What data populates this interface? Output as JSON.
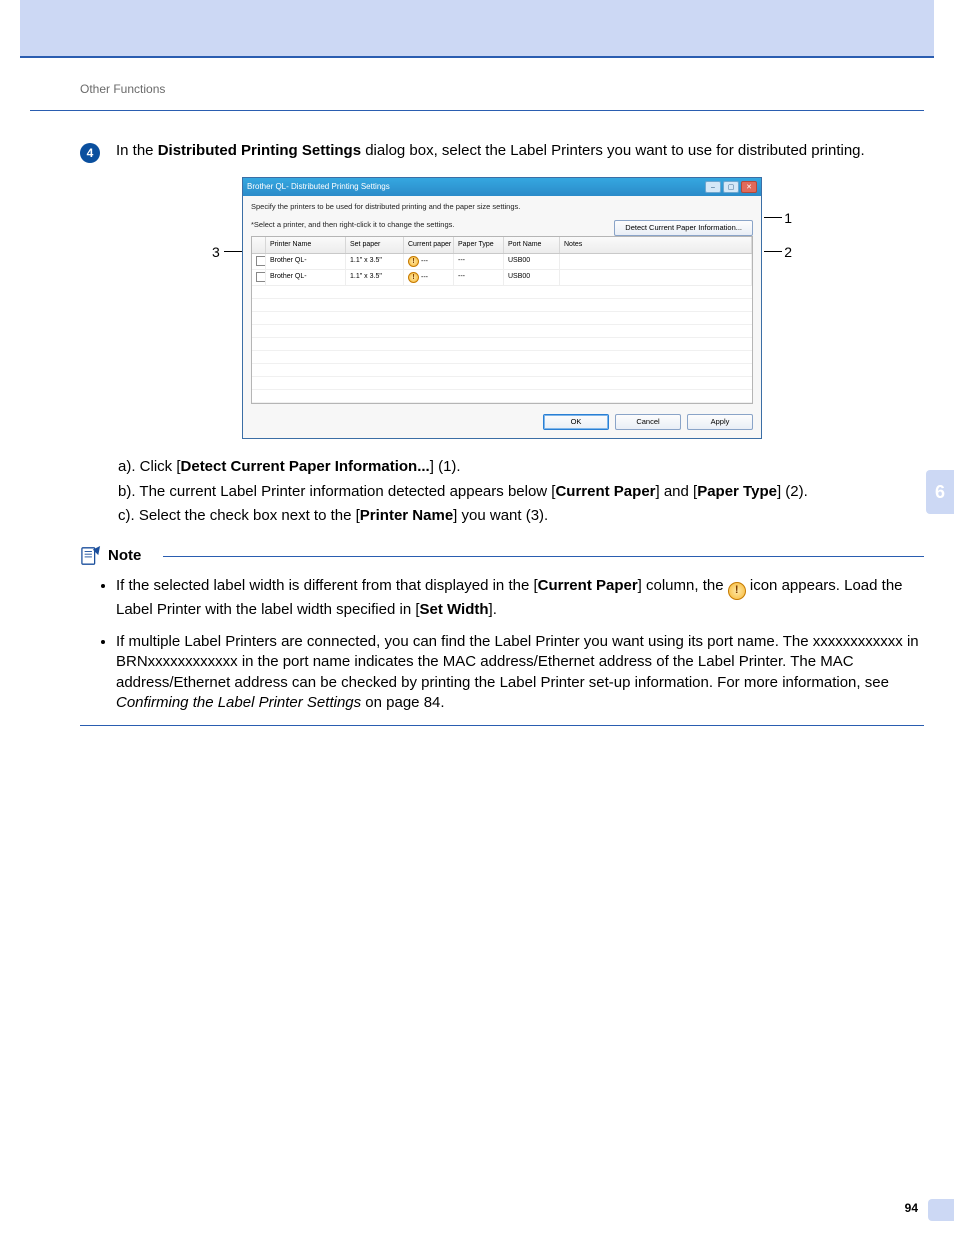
{
  "header": {
    "section": "Other Functions"
  },
  "step": {
    "number": "4",
    "text_pre": "In the ",
    "text_bold": "Distributed Printing Settings",
    "text_post": " dialog box, select the Label Printers you want to use for distributed printing."
  },
  "dialog": {
    "title": "Brother QL-          Distributed Printing Settings",
    "desc": "Specify the printers to be used for distributed printing and the paper size settings.",
    "sub": "*Select a printer, and then right-click it to change the settings.",
    "detect_btn": "Detect Current Paper Information...",
    "columns": {
      "chk": "",
      "printer_name": "Printer Name",
      "set_paper": "Set paper",
      "current_paper": "Current paper",
      "paper_type": "Paper Type",
      "port_name": "Port Name",
      "notes": "Notes"
    },
    "rows": [
      {
        "printer_name": "Brother QL-",
        "set_paper": "1.1\" x 3.5\"",
        "current_paper": "---",
        "paper_type": "---",
        "port_name": "USB00",
        "notes": ""
      },
      {
        "printer_name": "Brother QL-",
        "set_paper": "1.1\" x 3.5\"",
        "current_paper": "---",
        "paper_type": "---",
        "port_name": "USB00",
        "notes": ""
      }
    ],
    "buttons": {
      "ok": "OK",
      "cancel": "Cancel",
      "apply": "Apply"
    }
  },
  "callouts": {
    "one": "1",
    "two": "2",
    "three": "3"
  },
  "substeps": {
    "a_pre": "a). Click [",
    "a_bold": "Detect Current Paper Information...",
    "a_post": "] (1).",
    "b_pre": "b). The current Label Printer information detected appears below [",
    "b_bold1": "Current Paper",
    "b_mid": "] and [",
    "b_bold2": "Paper Type",
    "b_post": "] (2).",
    "c_pre": "c). Select the check box next to the [",
    "c_bold": "Printer Name",
    "c_post": "] you want (3)."
  },
  "note": {
    "title": "Note",
    "item1_pre": "If the selected label width is different from that displayed in the [",
    "item1_bold1": "Current Paper",
    "item1_mid": "] column, the ",
    "item1_post": " icon appears. Load the Label Printer with the label width specified in [",
    "item1_bold2": "Set Width",
    "item1_end": "].",
    "item2_a": "If multiple Label Printers are connected, you can find the Label Printer you want using its port name. The xxxxxxxxxxxx in BRNxxxxxxxxxxxx in the port name indicates the MAC address/Ethernet address of the Label Printer. The MAC address/Ethernet address can be checked by printing the Label Printer set-up information. For more information, see ",
    "item2_italic": "Confirming the Label Printer Settings",
    "item2_b": " on page 84."
  },
  "side": {
    "chapter": "6",
    "page": "94"
  }
}
